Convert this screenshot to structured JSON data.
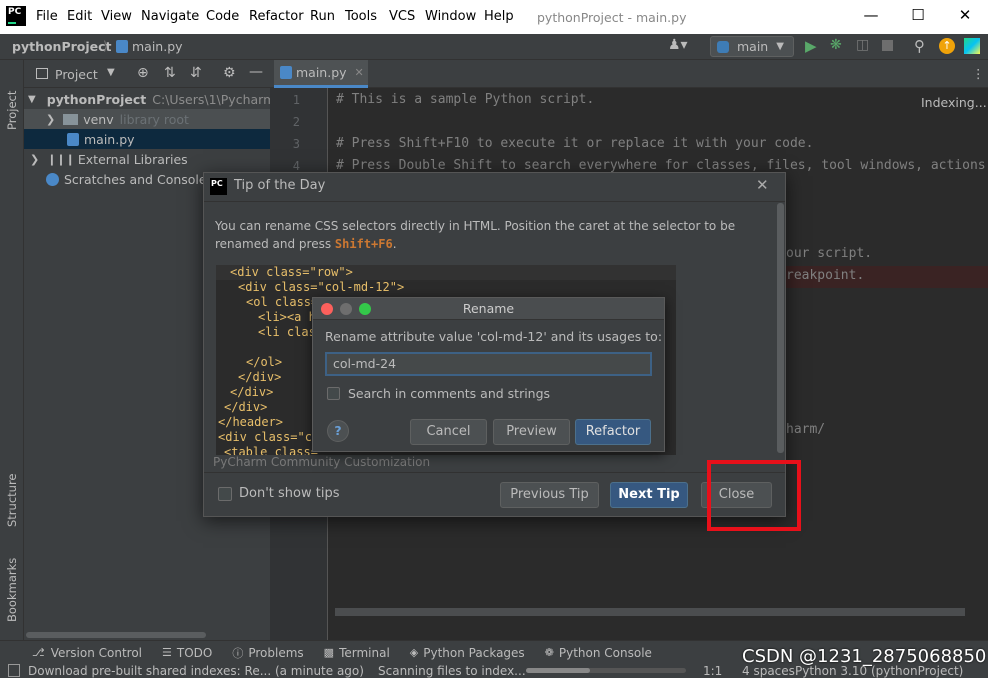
{
  "app": {
    "logo": "PC",
    "title": "pythonProject - main.py"
  },
  "menu": [
    "File",
    "Edit",
    "View",
    "Navigate",
    "Code",
    "Refactor",
    "Run",
    "Tools",
    "VCS",
    "Window",
    "Help"
  ],
  "navbar": {
    "project": "pythonProject",
    "file": "main.py",
    "run_config": "main"
  },
  "project_panel": {
    "title": "Project",
    "items": [
      {
        "label": "pythonProject",
        "extra": "C:\\Users\\1\\Pycharm"
      },
      {
        "label": "venv",
        "extra": "library root"
      },
      {
        "label": "main.py",
        "extra": ""
      },
      {
        "label": "External Libraries",
        "extra": ""
      },
      {
        "label": "Scratches and Consoles",
        "extra": ""
      }
    ]
  },
  "left_strip": {
    "project": "Project",
    "structure": "Structure",
    "bookmarks": "Bookmarks"
  },
  "editor": {
    "tab": "main.py",
    "indexing": "Indexing...",
    "line_numbers": [
      "1",
      "2",
      "3",
      "4"
    ],
    "lines": [
      "# This is a sample Python script.",
      "",
      "# Press Shift+F10 to execute it or replace it with your code.",
      "# Press Double Shift to search everywhere for classes, files, tool windows, actions"
    ],
    "fragment_1": "our script.",
    "fragment_2": "reakpoint.",
    "fragment_3": "harm/"
  },
  "tip_dialog": {
    "logo": "PC",
    "title": "Tip of the Day",
    "text": "You can rename CSS selectors directly in HTML. Position the caret at the selector to be renamed and press",
    "shortcut": "Shift+F6",
    "shortcut_suffix": ".",
    "preview_lines": [
      "<div class=\"row\">",
      "<div class=\"col-md-12\">",
      "<ol class=",
      "<li><a h",
      "<li clas",
      "",
      "</ol>",
      "</div>",
      "</div>",
      "</div>",
      "</header>",
      "<div class=\"co",
      "<table class="
    ],
    "footer_note": "PyCharm Community Customization",
    "dont_show": "Don't show tips",
    "prev_btn": "Previous Tip",
    "next_btn": "Next Tip",
    "close_btn": "Close"
  },
  "rename_dialog": {
    "title": "Rename",
    "prompt": "Rename attribute value 'col-md-12' and its usages to:",
    "value": "col-md-24",
    "checkbox": "Search in comments and strings",
    "help": "?",
    "cancel": "Cancel",
    "preview": "Preview",
    "refactor": "Refactor"
  },
  "bottom_tools": [
    "Version Control",
    "TODO",
    "Problems",
    "Terminal",
    "Python Packages",
    "Python Console"
  ],
  "status": {
    "left": "Download pre-built shared indexes: Re... (a minute ago)",
    "scanning": "Scanning files to index...",
    "pos": "1:1",
    "indent": "4 spaces",
    "interpreter": "Python 3.10 (pythonProject)",
    "watermark": "CSDN @1231_2875068850"
  },
  "colors": {
    "accent": "#365880",
    "highlight": "#e8101a",
    "shortcut": "#cc7832"
  }
}
